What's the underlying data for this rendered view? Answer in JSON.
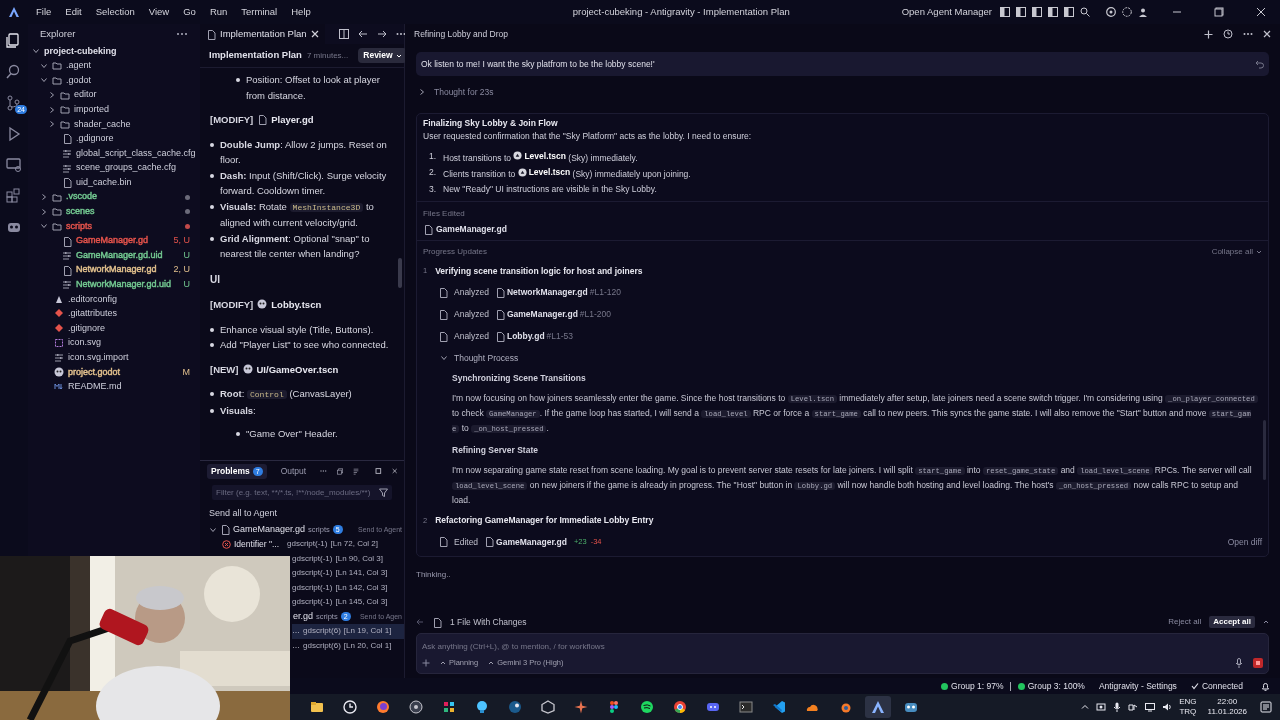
{
  "window": {
    "title": "project-cubeking - Antigravity - Implementation Plan",
    "menu": [
      "File",
      "Edit",
      "Selection",
      "View",
      "Go",
      "Run",
      "Terminal",
      "Help"
    ],
    "agent_manager": "Open Agent Manager"
  },
  "activity_bar": [
    {
      "kind": "files",
      "selected": true
    },
    {
      "kind": "search",
      "selected": false
    },
    {
      "kind": "source-control",
      "selected": false,
      "badge": "24"
    },
    {
      "kind": "run",
      "selected": false
    },
    {
      "kind": "remote",
      "selected": false
    },
    {
      "kind": "extensions",
      "selected": false
    },
    {
      "kind": "robot",
      "selected": false
    }
  ],
  "explorer": {
    "title": "Explorer",
    "tree": [
      {
        "name": "project-cubeking",
        "kind": "root",
        "expanded": true,
        "children": [
          {
            "name": ".agent",
            "kind": "folder",
            "expanded": true
          },
          {
            "name": ".godot",
            "kind": "folder",
            "expanded": true,
            "children": [
              {
                "name": "editor",
                "kind": "folder",
                "expanded": false
              },
              {
                "name": "imported",
                "kind": "folder",
                "expanded": false
              },
              {
                "name": "shader_cache",
                "kind": "folder",
                "expanded": false
              },
              {
                "name": ".gdignore",
                "kind": "file"
              },
              {
                "name": "global_script_class_cache.cfg",
                "kind": "config"
              },
              {
                "name": "scene_groups_cache.cfg",
                "kind": "config"
              },
              {
                "name": "uid_cache.bin",
                "kind": "file"
              }
            ]
          },
          {
            "name": ".vscode",
            "kind": "folder",
            "expanded": false,
            "color": "#73c991",
            "dot": {
              "color": "#6b6b7a"
            }
          },
          {
            "name": "scenes",
            "kind": "folder",
            "expanded": false,
            "color": "#73c991",
            "dot": {
              "color": "#6b6b7a"
            }
          },
          {
            "name": "scripts",
            "kind": "folder",
            "expanded": true,
            "color": "#e5534b",
            "dot": {
              "color": "#c24a4a"
            },
            "children": [
              {
                "name": "GameManager.gd",
                "kind": "file",
                "color": "#e5534b",
                "badge": "5, U"
              },
              {
                "name": "GameManager.gd.uid",
                "kind": "config",
                "color": "#73c991",
                "badge": "U"
              },
              {
                "name": "NetworkManager.gd",
                "kind": "file",
                "color": "#e2c08d",
                "badge": "2, U"
              },
              {
                "name": "NetworkManager.gd.uid",
                "kind": "config",
                "color": "#73c991",
                "badge": "U"
              }
            ]
          },
          {
            "name": ".editorconfig",
            "kind": "settings"
          },
          {
            "name": ".gitattributes",
            "kind": "git"
          },
          {
            "name": ".gitignore",
            "kind": "git"
          },
          {
            "name": "icon.svg"
          },
          {
            "name": "icon.svg.import",
            "kind": "config"
          },
          {
            "name": "project.godot",
            "kind": "godot",
            "color": "#e2c08d",
            "badge": "M"
          },
          {
            "name": "README.md",
            "kind": "markdown"
          }
        ]
      }
    ]
  },
  "editor": {
    "tab": "Implementation Plan",
    "header": {
      "title": "Implementation Plan",
      "time": "7 minutes...",
      "review": "Review"
    },
    "blocks": [
      {
        "kind": "sublist",
        "items": [
          [
            {
              "text": "Position: Offset to look at player from distance."
            }
          ]
        ]
      },
      {
        "kind": "file_heading",
        "tag": "[MODIFY]",
        "file": {
          "kind": "file",
          "name": "Player.gd"
        }
      },
      {
        "kind": "list",
        "items": [
          [
            {
              "text": "**Double Jump**: Allow 2 jumps. Reset on floor."
            }
          ],
          [
            {
              "text": "**Dash:** Input (Shift/Click). Surge velocity forward. Cooldown timer."
            }
          ],
          [
            {
              "text": "**Visuals:** Rotate "
            },
            {
              "code": "MeshInstance3D"
            },
            {
              "text": " to aligned with current velocity/grid."
            }
          ],
          [
            {
              "text": "**Grid Alignment**: Optional \"snap\" to nearest tile center when landing?"
            }
          ]
        ]
      },
      {
        "kind": "heading",
        "text": "UI"
      },
      {
        "kind": "file_heading",
        "tag": "[MODIFY]",
        "file": {
          "kind": "godot",
          "name": "Lobby.tscn"
        }
      },
      {
        "kind": "list",
        "items": [
          [
            {
              "text": "Enhance visual style (Title, Buttons)."
            }
          ],
          [
            {
              "text": "Add \"Player List\" to see who connected."
            }
          ]
        ]
      },
      {
        "kind": "file_heading",
        "tag": "[NEW]",
        "file": {
          "kind": "godot",
          "name": "UI/GameOver.tscn"
        }
      },
      {
        "kind": "list",
        "items": [
          [
            {
              "text": "**Root**: "
            },
            {
              "code": "Control"
            },
            {
              "text": " (CanvasLayer)"
            }
          ],
          [
            {
              "text": "**Visuals**:"
            }
          ]
        ]
      },
      {
        "kind": "sublist",
        "items": [
          [
            {
              "text": "\"Game Over\" Header."
            }
          ]
        ]
      }
    ]
  },
  "problems": {
    "tabs": [
      {
        "label": "Problems",
        "selected": true,
        "count": "7"
      },
      {
        "label": "Output",
        "selected": false
      }
    ],
    "filter_placeholder": "Filter (e.g. text, **/*.ts, !**/node_modules/**)",
    "send_all": "Send all to Agent",
    "groups": [
      {
        "file": "GameManager.gd",
        "folder": "scripts",
        "count": "5",
        "action": "Send to Agent",
        "rows": [
          {
            "kind": "error",
            "text": "Identifier \"...",
            "source": "gdscript(-1)",
            "location": "[Ln 72, Col 2]",
            "selected": false
          },
          {
            "source": "gdscript(-1)",
            "location": "[Ln 90, Col 3]",
            "selected": false
          },
          {
            "source": "gdscript(-1)",
            "location": "[Ln 141, Col 3]",
            "selected": false
          },
          {
            "source": "gdscript(-1)",
            "location": "[Ln 142, Col 3]",
            "selected": false
          },
          {
            "source": "gdscript(-1)",
            "location": "[Ln 145, Col 3]",
            "selected": false
          }
        ]
      },
      {
        "file": "er.gd",
        "folder": "scripts",
        "count": "2",
        "action": "Send to Agen",
        "rows": [
          {
            "text": "…",
            "source": "gdscript(6)",
            "location": "[Ln 19, Col 1]",
            "selected": true
          },
          {
            "text": "…",
            "source": "gdscript(6)",
            "location": "[Ln 20, Col 1]",
            "selected": false
          }
        ]
      }
    ]
  },
  "agent": {
    "title": "Refining Lobby and Drop",
    "user_message": "Ok listen to me! I want the sky platfrom to be the lobby scene!'",
    "thought": {
      "label": "Thought for 23s",
      "expanded": false
    },
    "card": {
      "title": "Finalizing Sky Lobby & Join Flow",
      "intro": "User requested confirmation that the \"Sky Platform\" acts as the lobby. I need to ensure:",
      "steps": [
        {
          "number": "1.",
          "segments": [
            {
              "text": "Host transitions to "
            },
            {
              "file": "Level.tscn"
            },
            {
              "text": " (Sky) immediately."
            }
          ]
        },
        {
          "number": "2.",
          "segments": [
            {
              "text": "Clients transition to "
            },
            {
              "file": "Level.tscn"
            },
            {
              "text": " (Sky) immediately upon joining."
            }
          ]
        },
        {
          "number": "3.",
          "segments": [
            {
              "text": "New \"Ready\" UI instructions are visible in the Sky Lobby."
            }
          ]
        }
      ],
      "files_edited_label": "Files Edited",
      "files_edited": [
        "GameManager.gd"
      ],
      "progress_label": "Progress Updates",
      "collapse_all": "Collapse all",
      "updates": [
        {
          "number": "1",
          "title": "Verifying scene transition logic for host and joiners",
          "actions": [
            {
              "verb": "Analyzed",
              "file": "NetworkManager.gd",
              "range": "#L1-120"
            },
            {
              "verb": "Analyzed",
              "file": "GameManager.gd",
              "range": "#L1-200"
            },
            {
              "verb": "Analyzed",
              "file": "Lobby.gd",
              "range": "#L1-53"
            }
          ],
          "thought_process": {
            "label": "Thought Process",
            "expanded": true,
            "sections": [
              {
                "title": "Synchronizing Scene Transitions",
                "body": [
                  {
                    "text": "I'm now focusing on how joiners seamlessly enter the game. Since the host transitions to "
                  },
                  {
                    "code": "Level.tscn"
                  },
                  {
                    "text": " immediately after setup, late joiners need a scene switch trigger. I'm considering using "
                  },
                  {
                    "code": "_on_player_connected"
                  },
                  {
                    "text": " to check "
                  },
                  {
                    "code": "GameManager"
                  },
                  {
                    "text": ". If the game loop has started, I will send a "
                  },
                  {
                    "code": "load_level"
                  },
                  {
                    "text": " RPC or force a "
                  },
                  {
                    "code": "start_game"
                  },
                  {
                    "text": " call to new peers. This syncs the game state. I will also remove the \"Start\" button and move "
                  },
                  {
                    "code": "start_game"
                  },
                  {
                    "text": " to "
                  },
                  {
                    "code": "_on_host_pressed"
                  },
                  {
                    "text": "."
                  }
                ]
              },
              {
                "title": "Refining Server State",
                "body": [
                  {
                    "text": "I'm now separating game state reset from scene loading. My goal is to prevent server state resets for late joiners. I will split "
                  },
                  {
                    "code": "start_game"
                  },
                  {
                    "text": " into "
                  },
                  {
                    "code": "reset_game_state"
                  },
                  {
                    "text": " and "
                  },
                  {
                    "code": "load_level_scene"
                  },
                  {
                    "text": " RPCs. The server will call "
                  },
                  {
                    "code": "load_level_scene"
                  },
                  {
                    "text": " on new joiners if the game is already in progress. The \"Host\" button in "
                  },
                  {
                    "code": "Lobby.gd"
                  },
                  {
                    "text": " will now handle both hosting and level loading. The host's "
                  },
                  {
                    "code": "_on_host_pressed"
                  },
                  {
                    "text": " now calls RPC to setup and load."
                  }
                ]
              }
            ]
          }
        },
        {
          "number": "2",
          "title": "Refactoring GameManager for Immediate Lobby Entry",
          "actions": [
            {
              "verb": "Edited",
              "file": "GameManager.gd",
              "added": "+23",
              "removed": "-34",
              "link": "Open diff"
            }
          ]
        }
      ]
    },
    "status": "Thinking..",
    "changes": {
      "label": "1 File With Changes",
      "reject": "Reject all",
      "accept": "Accept all"
    },
    "input": {
      "placeholder": "Ask anything (Ctrl+L), @ to mention, / for workflows",
      "mode": "Planning",
      "model": "Gemini 3 Pro (High)"
    }
  },
  "status_bar": {
    "items": [
      {
        "kind": "dot",
        "text": "Group 1: 97%",
        "color": "#22c55e"
      },
      {
        "kind": "separator",
        "text": "|"
      },
      {
        "kind": "dot",
        "text": "Group 3: 100%",
        "color": "#22c55e"
      },
      {
        "kind": "text",
        "text": "Antigravity - Settings"
      },
      {
        "kind": "check",
        "text": "Connected"
      },
      {
        "kind": "bell"
      }
    ]
  },
  "taskbar": {
    "apps": [
      {
        "kind": "folder",
        "selected": false
      },
      {
        "kind": "clock",
        "selected": false
      },
      {
        "kind": "firefox",
        "selected": false
      },
      {
        "kind": "obs",
        "selected": false
      },
      {
        "kind": "slack",
        "selected": false
      },
      {
        "kind": "bulb",
        "selected": false
      },
      {
        "kind": "steam",
        "selected": false
      },
      {
        "kind": "cube",
        "selected": false
      },
      {
        "kind": "star",
        "selected": false
      },
      {
        "kind": "figma",
        "selected": false
      },
      {
        "kind": "spotify",
        "selected": false
      },
      {
        "kind": "chrome",
        "selected": false
      },
      {
        "kind": "discord",
        "selected": false
      },
      {
        "kind": "terminal",
        "selected": false
      },
      {
        "kind": "vscode",
        "selected": false
      },
      {
        "kind": "cloud",
        "selected": false
      },
      {
        "kind": "blender",
        "selected": false
      },
      {
        "kind": "antigravity",
        "selected": true
      },
      {
        "kind": "godot",
        "selected": false
      }
    ],
    "language": "ENG",
    "layout": "TRQ",
    "time": "22:00",
    "date": "11.01.2026"
  }
}
